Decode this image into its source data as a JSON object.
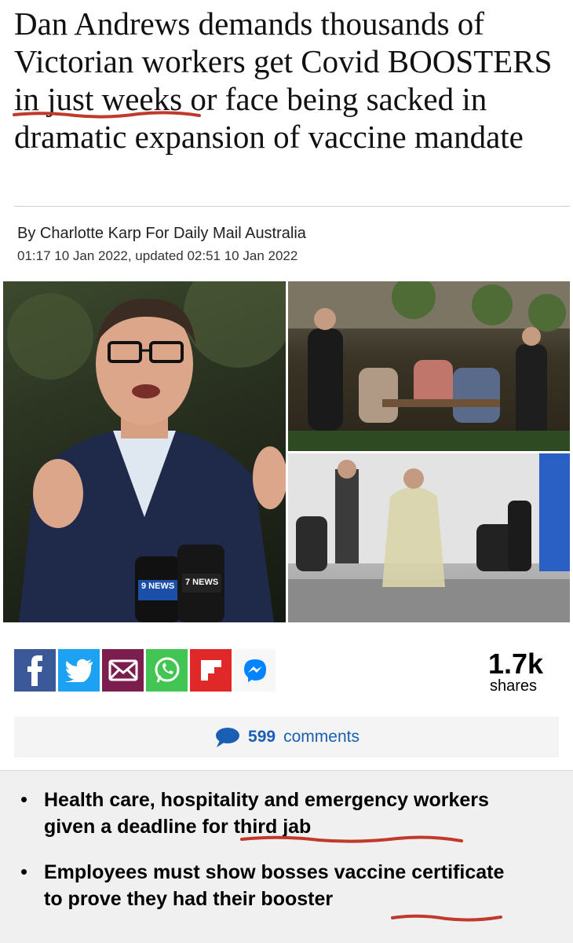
{
  "headline": "Dan Andrews demands thousands of Victorian workers get Covid BOOSTERS in just weeks or face being sacked in dramatic expansion of vaccine mandate",
  "byline": "By Charlotte Karp For Daily Mail Australia",
  "dateline": "01:17 10 Jan 2022, updated 02:51 10 Jan 2022",
  "photos": {
    "microphone_labels": [
      "9 NEWS",
      "7 NEWS"
    ]
  },
  "share": {
    "buttons": [
      {
        "icon": "facebook-icon",
        "color": "#3b5998"
      },
      {
        "icon": "twitter-icon",
        "color": "#1da1f2"
      },
      {
        "icon": "mail-icon",
        "color": "#7b1e4d"
      },
      {
        "icon": "whatsapp-icon",
        "color": "#43c553"
      },
      {
        "icon": "flipboard-icon",
        "color": "#e12828"
      },
      {
        "icon": "messenger-icon",
        "color": "#0084ff"
      }
    ],
    "count": "1.7k",
    "label": "shares"
  },
  "comments": {
    "count": "599",
    "label": "comments",
    "color": "#1a5fb4"
  },
  "bullets": [
    "Health care, hospitality and emergency workers given a deadline for third jab",
    "Employees must show bosses vaccine certificate to prove they had their booster"
  ],
  "annotation_color": "#c0392b"
}
